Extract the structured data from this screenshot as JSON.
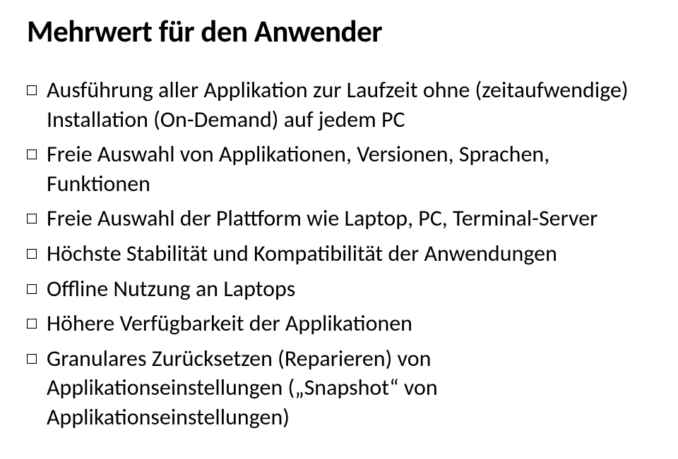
{
  "title": "Mehrwert für den Anwender",
  "bullets": [
    "Ausführung aller Applikation zur Laufzeit ohne (zeitaufwendige) Installation (On-Demand) auf jedem PC",
    "Freie Auswahl von Applikationen, Versionen, Sprachen, Funktionen",
    "Freie Auswahl der Plattform wie Laptop, PC, Terminal-Server",
    "Höchste Stabilität und Kompatibilität der Anwendungen",
    "Offline Nutzung an Laptops",
    "Höhere Verfügbarkeit der Applikationen",
    "Granulares Zurücksetzen (Reparieren) von Applikationseinstellungen („Snapshot“ von Applikationseinstellungen)"
  ]
}
